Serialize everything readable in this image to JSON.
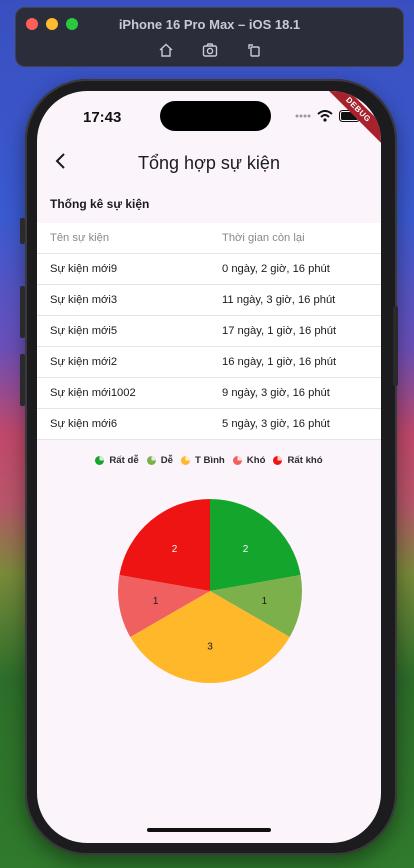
{
  "simulator": {
    "title": "iPhone 16 Pro Max – iOS 18.1"
  },
  "status": {
    "time": "17:43",
    "debug": "DEBUG"
  },
  "appbar": {
    "title": "Tổng hợp sự kiện"
  },
  "section": {
    "title": "Thống kê sự kiện"
  },
  "table": {
    "headers": [
      "Tên sự kiện",
      "Thời gian còn lại"
    ],
    "rows": [
      [
        "Sự kiện mới9",
        "0 ngày, 2 giờ, 16 phút"
      ],
      [
        "Sự kiện mới3",
        "11 ngày, 3 giờ, 16 phút"
      ],
      [
        "Sự kiện mới5",
        "17 ngày, 1 giờ, 16 phút"
      ],
      [
        "Sự kiện mới2",
        "16 ngày, 1 giờ, 16 phút"
      ],
      [
        "Sự kiện mới1002",
        "9 ngày, 3 giờ, 16 phút"
      ],
      [
        "Sự kiện mới6",
        "5 ngày, 3 giờ, 16 phút"
      ]
    ]
  },
  "chart_data": {
    "type": "pie",
    "categories": [
      "Rất dễ",
      "Dễ",
      "T Bình",
      "Khó",
      "Rất khó"
    ],
    "values": [
      2,
      1,
      3,
      1,
      2
    ],
    "colors": [
      "#13a52c",
      "#7bb04a",
      "#ffb82a",
      "#f06061",
      "#ef1414"
    ],
    "legend": "top"
  }
}
